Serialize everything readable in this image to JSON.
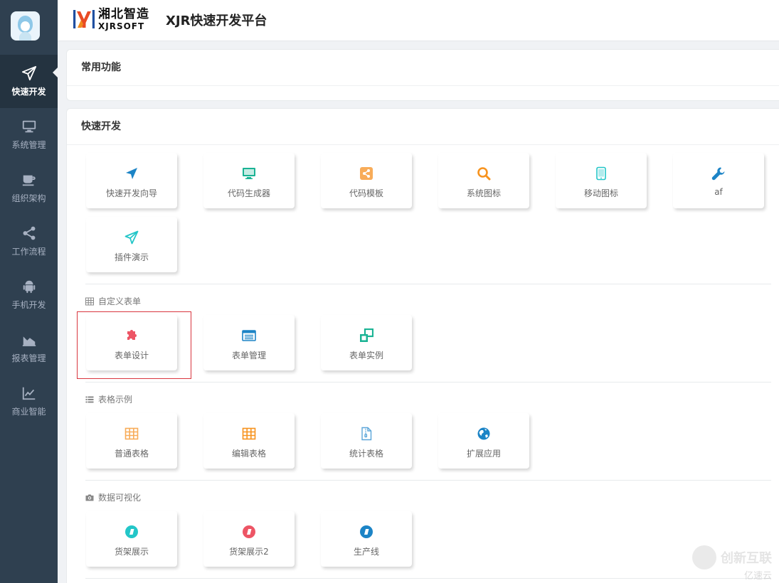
{
  "sidebar": {
    "items": [
      {
        "label": "快速开发",
        "icon": "paper-plane-icon",
        "active": true
      },
      {
        "label": "系统管理",
        "icon": "monitor-icon"
      },
      {
        "label": "组织架构",
        "icon": "coffee-icon"
      },
      {
        "label": "工作流程",
        "icon": "share-icon"
      },
      {
        "label": "手机开发",
        "icon": "android-icon"
      },
      {
        "label": "报表管理",
        "icon": "area-chart-icon"
      },
      {
        "label": "商业智能",
        "icon": "line-chart-icon"
      }
    ]
  },
  "header": {
    "logo_cn": "湘北智造",
    "logo_en": "XJRSOFT",
    "title": "XJR快速开发平台"
  },
  "panels": {
    "common": {
      "title": "常用功能"
    },
    "quick": {
      "title": "快速开发"
    }
  },
  "tiles": {
    "row1": [
      {
        "label": "快速开发向导",
        "icon": "location-arrow-icon",
        "color": "#1c84c6"
      },
      {
        "label": "代码生成器",
        "icon": "desktop-icon",
        "color": "#1ab394"
      },
      {
        "label": "代码模板",
        "icon": "share-square-icon",
        "color": "#f8ac59"
      },
      {
        "label": "系统图标",
        "icon": "search-icon",
        "color": "#f7931e"
      },
      {
        "label": "移动图标",
        "icon": "tablet-icon",
        "color": "#23c6c8"
      },
      {
        "label": "af",
        "icon": "wrench-icon",
        "color": "#1c84c6"
      }
    ],
    "row2": [
      {
        "label": "插件演示",
        "icon": "paper-plane-icon",
        "color": "#23c6c8"
      }
    ]
  },
  "sections": [
    {
      "title": "自定义表单",
      "icon": "table-icon",
      "items": [
        {
          "label": "表单设计",
          "icon": "puzzle-icon",
          "color": "#ed5565"
        },
        {
          "label": "表单管理",
          "icon": "list-alt-icon",
          "color": "#1c84c6"
        },
        {
          "label": "表单实例",
          "icon": "clone-icon",
          "color": "#1ab394"
        }
      ]
    },
    {
      "title": "表格示例",
      "icon": "list-icon",
      "items": [
        {
          "label": "普通表格",
          "icon": "grid-icon",
          "color": "#f8ac59"
        },
        {
          "label": "编辑表格",
          "icon": "grid-icon",
          "color": "#f7931e"
        },
        {
          "label": "统计表格",
          "icon": "file-zip-icon",
          "color": "#5ba6d9"
        },
        {
          "label": "扩展应用",
          "icon": "globe-icon",
          "color": "#1c84c6"
        }
      ]
    },
    {
      "title": "数据可视化",
      "icon": "camera-icon",
      "items": [
        {
          "label": "货架展示",
          "icon": "badge-icon",
          "color": "#23c6c8"
        },
        {
          "label": "货架展示2",
          "icon": "badge-icon",
          "color": "#ed5565"
        },
        {
          "label": "生产线",
          "icon": "badge-icon",
          "color": "#1c84c6"
        }
      ]
    }
  ],
  "watermark": {
    "line1": "创新互联",
    "line2": "亿速云"
  }
}
